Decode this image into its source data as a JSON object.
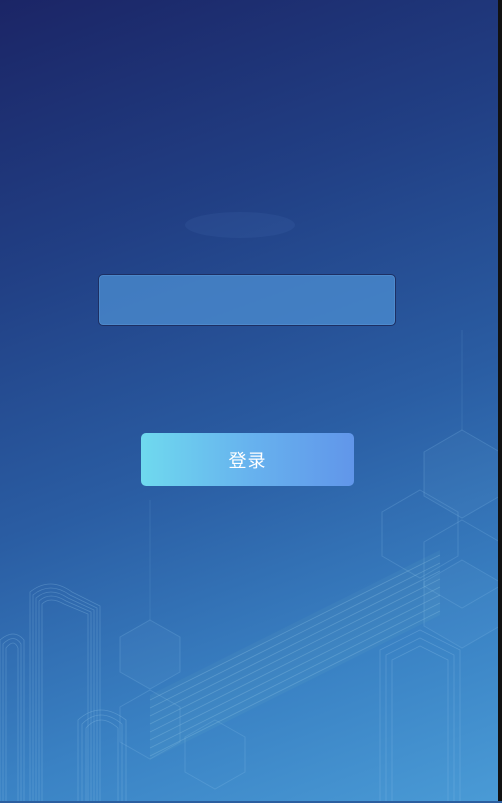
{
  "login_form": {
    "username_field": {
      "value": "",
      "placeholder": ""
    },
    "submit_label": "登录"
  },
  "colors": {
    "background_top": "#1b2566",
    "background_bottom": "#4a9bd6",
    "input_fill": "#4a8cd0",
    "input_border": "#1d2f63",
    "button_gradient_start": "#6fd9ee",
    "button_gradient_end": "#6196ea",
    "button_text": "#ffffff"
  },
  "icons": {
    "background_art": "city-skyline-hexagon-illustration"
  }
}
